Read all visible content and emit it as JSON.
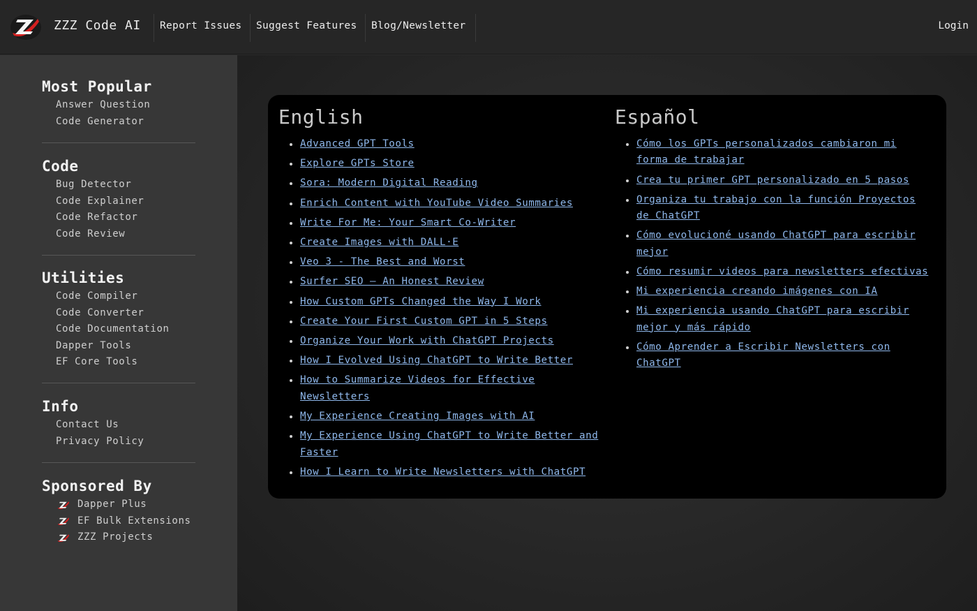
{
  "header": {
    "brand": "ZZZ Code AI",
    "nav": [
      "Report Issues",
      "Suggest Features",
      "Blog/Newsletter"
    ],
    "login": "Login"
  },
  "sidebar": {
    "most_popular": {
      "title": "Most Popular",
      "items": [
        "Answer Question",
        "Code Generator"
      ]
    },
    "code": {
      "title": "Code",
      "items": [
        "Bug Detector",
        "Code Explainer",
        "Code Refactor",
        "Code Review"
      ]
    },
    "utilities": {
      "title": "Utilities",
      "items": [
        "Code Compiler",
        "Code Converter",
        "Code Documentation",
        "Dapper Tools",
        "EF Core Tools"
      ]
    },
    "info": {
      "title": "Info",
      "items": [
        "Contact Us",
        "Privacy Policy"
      ]
    },
    "sponsored": {
      "title": "Sponsored By",
      "items": [
        "Dapper Plus",
        "EF Bulk Extensions",
        "ZZZ Projects"
      ]
    }
  },
  "main": {
    "english": {
      "title": "English",
      "links": [
        "Advanced GPT Tools",
        "Explore GPTs Store",
        "Sora: Modern Digital Reading",
        "Enrich Content with YouTube Video Summaries",
        "Write For Me: Your Smart Co-Writer",
        "Create Images with DALL·E",
        "Veo 3 - The Best and Worst",
        "Surfer SEO – An Honest Review",
        "How Custom GPTs Changed the Way I Work",
        "Create Your First Custom GPT in 5 Steps",
        "Organize Your Work with ChatGPT Projects",
        "How I Evolved Using ChatGPT to Write Better",
        "How to Summarize Videos for Effective Newsletters",
        "My Experience Creating Images with AI",
        "My Experience Using ChatGPT to Write Better and Faster",
        "How I Learn to Write Newsletters with ChatGPT"
      ]
    },
    "spanish": {
      "title": "Español",
      "links": [
        "Cómo los GPTs personalizados cambiaron mi forma de trabajar",
        "Crea tu primer GPT personalizado en 5 pasos",
        "Organiza tu trabajo con la función Proyectos de ChatGPT",
        "Cómo evolucioné usando ChatGPT para escribir mejor",
        "Cómo resumir videos para newsletters efectivas",
        "Mi experiencia creando imágenes con IA",
        "Mi experiencia usando ChatGPT para escribir mejor y más rápido",
        "Cómo Aprender a Escribir Newsletters con ChatGPT"
      ]
    }
  },
  "colors": {
    "link": "#8fb8ec",
    "logo_red": "#d42020",
    "card_bg": "#000000"
  }
}
